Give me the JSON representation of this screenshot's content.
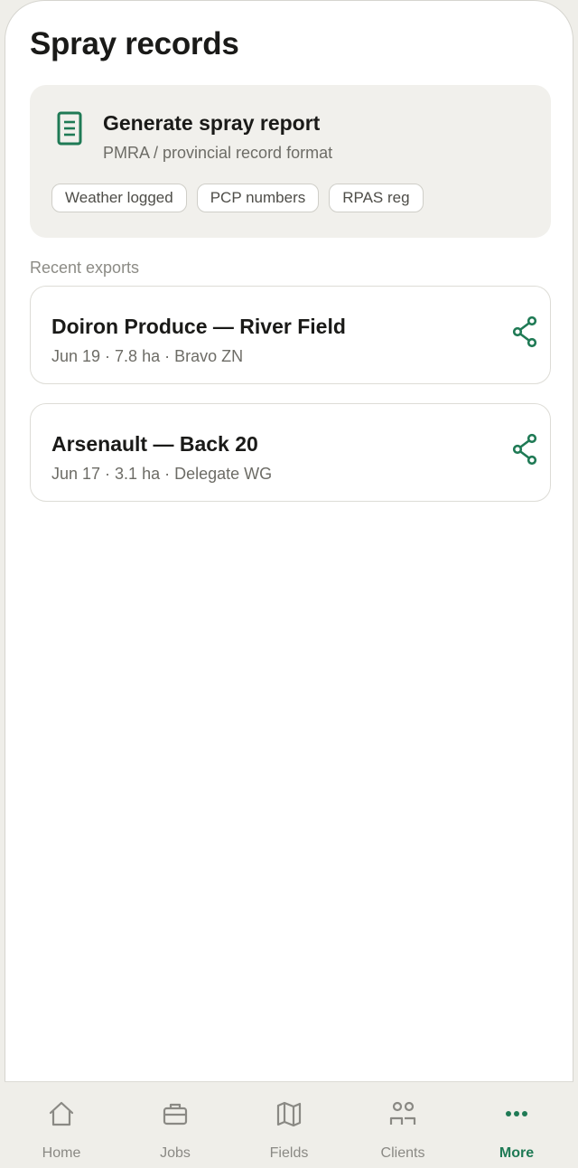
{
  "page": {
    "title": "Spray records"
  },
  "report": {
    "title": "Generate spray report",
    "subtitle": "PMRA / provincial record format",
    "chips": [
      "Weather logged",
      "PCP numbers",
      "RPAS reg"
    ]
  },
  "recent": {
    "label": "Recent exports",
    "items": [
      {
        "title": "Doiron Produce — River Field",
        "meta": "Jun 19 · 7.8 ha · Bravo ZN"
      },
      {
        "title": "Arsenault — Back 20",
        "meta": "Jun 17 · 3.1 ha · Delegate WG"
      }
    ]
  },
  "tabs": [
    {
      "label": "Home",
      "icon": "home-icon"
    },
    {
      "label": "Jobs",
      "icon": "briefcase-icon"
    },
    {
      "label": "Fields",
      "icon": "map-icon"
    },
    {
      "label": "Clients",
      "icon": "people-icon"
    },
    {
      "label": "More",
      "icon": "more-icon",
      "active": true
    }
  ],
  "colors": {
    "accent": "#1f7a55",
    "card": "#f1f0ec",
    "background": "#efeee9"
  }
}
